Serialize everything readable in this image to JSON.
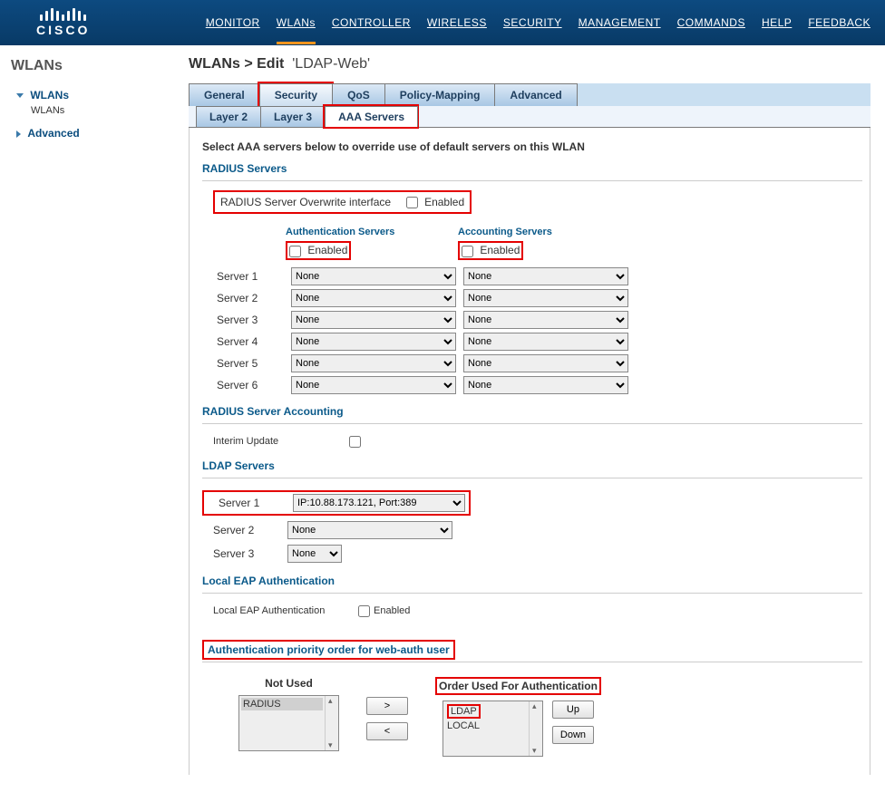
{
  "brand": "CISCO",
  "topnav": {
    "monitor": "MONITOR",
    "wlans": "WLANs",
    "controller": "CONTROLLER",
    "wireless": "WIRELESS",
    "security": "SECURITY",
    "management": "MANAGEMENT",
    "commands": "COMMANDS",
    "help": "HELP",
    "feedback": "FEEDBACK"
  },
  "sidebar": {
    "title": "WLANs",
    "wlans_group": "WLANs",
    "wlans_item": "WLANs",
    "advanced": "Advanced"
  },
  "crumb": {
    "root": "WLANs",
    "edit": "Edit",
    "name": "'LDAP-Web'"
  },
  "tabs": {
    "general": "General",
    "security": "Security",
    "qos": "QoS",
    "policy": "Policy-Mapping",
    "advanced": "Advanced"
  },
  "subtabs": {
    "layer2": "Layer 2",
    "layer3": "Layer 3",
    "aaa": "AAA Servers"
  },
  "text": {
    "instruction": "Select AAA servers below to override use of default servers on this WLAN",
    "radius_servers": "RADIUS Servers",
    "radius_overwrite": "RADIUS Server Overwrite interface",
    "enabled": "Enabled",
    "auth_servers": "Authentication Servers",
    "acct_servers": "Accounting Servers",
    "radius_acct": "RADIUS Server Accounting",
    "interim": "Interim Update",
    "ldap_servers": "LDAP Servers",
    "local_eap_title": "Local EAP Authentication",
    "local_eap_label": "Local EAP Authentication",
    "auth_priority": "Authentication priority order for web-auth user",
    "not_used": "Not Used",
    "order_used": "Order Used For Authentication",
    "up": "Up",
    "down": "Down",
    "gt": ">",
    "lt": "<"
  },
  "servers": {
    "labels": [
      "Server 1",
      "Server 2",
      "Server 3",
      "Server 4",
      "Server 5",
      "Server 6"
    ],
    "auth_values": [
      "None",
      "None",
      "None",
      "None",
      "None",
      "None"
    ],
    "acct_values": [
      "None",
      "None",
      "None",
      "None",
      "None",
      "None"
    ]
  },
  "ldap": {
    "labels": [
      "Server 1",
      "Server 2",
      "Server 3"
    ],
    "values": [
      "IP:10.88.173.121, Port:389",
      "None",
      "None"
    ]
  },
  "priority": {
    "not_used": [
      "RADIUS"
    ],
    "order_used": [
      "LDAP",
      "LOCAL"
    ]
  }
}
